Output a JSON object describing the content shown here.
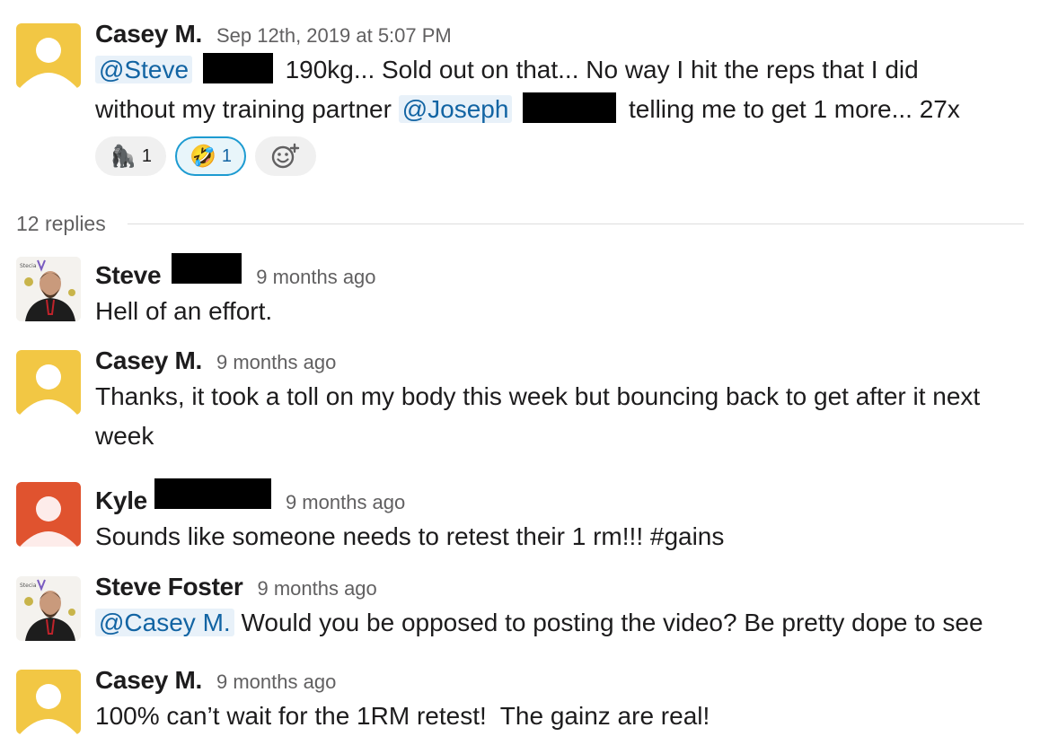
{
  "thread_root": {
    "author": "Casey M.",
    "timestamp": "Sep 12th, 2019 at 5:07 PM",
    "mention_1": "@Steve",
    "text_part1": "190kg... Sold out on that... No way I hit the reps that I did without my training partner",
    "mention_2": "@Joseph",
    "text_part2": "telling me to get 1 more... 27x",
    "reactions": [
      {
        "emoji": "gorilla-emoji",
        "glyph": "🦍",
        "count": "1"
      },
      {
        "emoji": "rofl-emoji",
        "glyph": "🤣",
        "count": "1"
      }
    ],
    "add_reaction_icon": "add-reaction-icon"
  },
  "replies_label": "12 replies",
  "replies": [
    {
      "author": "Steve",
      "time": "9 months ago",
      "text": "Hell of an effort."
    },
    {
      "author": "Casey M.",
      "time": "9 months ago",
      "text": "Thanks, it took a toll on my body this week but bouncing back to get after it next week"
    },
    {
      "author": "Kyle",
      "time": "9 months ago",
      "text": "Sounds like someone needs to retest their 1 rm!!! #gains"
    },
    {
      "author": "Steve Foster",
      "time": "9 months ago",
      "mention": "@Casey M.",
      "text": "Would you be opposed to posting the video? Be pretty dope to see"
    },
    {
      "author": "Casey M.",
      "time": "9 months ago",
      "text": "100% can’t wait for the 1RM retest!  The gainz are real!"
    }
  ],
  "colors": {
    "avatar_yellow": "#f2c744",
    "avatar_red": "#e0532f",
    "mention_text": "#1264a3",
    "mention_bg": "#e8f1f9"
  }
}
